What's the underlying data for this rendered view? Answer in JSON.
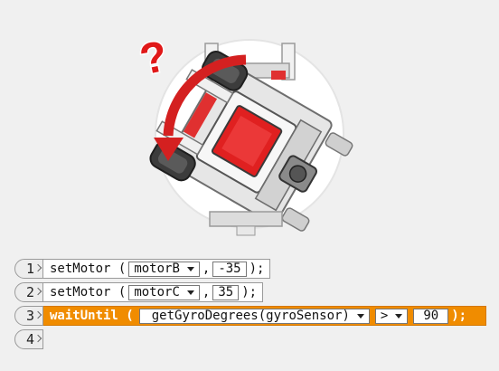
{
  "illustration": {
    "question_mark": "?",
    "colors": {
      "arrow": "#d42020",
      "question": "#e01818",
      "robot_screen": "#e02020"
    }
  },
  "code_lines": [
    {
      "num": "1",
      "cmd": "setMotor",
      "open": "(",
      "motor": "motorB",
      "comma": ",",
      "value": "-35",
      "close": ");"
    },
    {
      "num": "2",
      "cmd": "setMotor",
      "open": "(",
      "motor": "motorC",
      "comma": ",",
      "value": "35",
      "close": ");"
    },
    {
      "num": "3",
      "cmd": "waitUntil",
      "open": "(",
      "sensor": "getGyroDegrees(gyroSensor)",
      "operator": ">",
      "value": "90",
      "close": ");"
    },
    {
      "num": "4"
    }
  ],
  "colors": {
    "active_line": "#f08c00",
    "line_bg": "#ffffff",
    "gutter_bg": "#ededed"
  }
}
